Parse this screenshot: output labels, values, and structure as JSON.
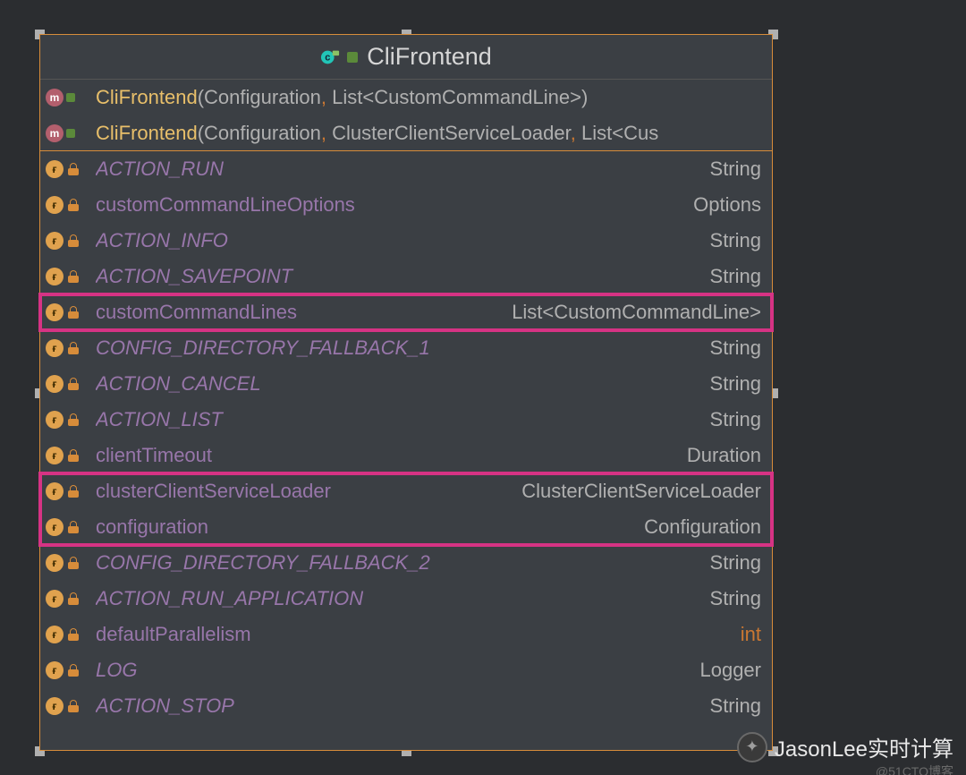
{
  "title": "CliFrontend",
  "constructors": [
    {
      "name": "CliFrontend",
      "sig_html": "(Configuration, List<CustomCommandLine>)"
    },
    {
      "name": "CliFrontend",
      "sig_html": "(Configuration, ClusterClientServiceLoader, List<Cus"
    }
  ],
  "fields": [
    {
      "name": "ACTION_RUN",
      "type": "String",
      "static": true
    },
    {
      "name": "customCommandLineOptions",
      "type": "Options",
      "static": false
    },
    {
      "name": "ACTION_INFO",
      "type": "String",
      "static": true
    },
    {
      "name": "ACTION_SAVEPOINT",
      "type": "String",
      "static": true
    },
    {
      "name": "customCommandLines",
      "type": "List<CustomCommandLine>",
      "static": false,
      "hl": 1
    },
    {
      "name": "CONFIG_DIRECTORY_FALLBACK_1",
      "type": "String",
      "static": true
    },
    {
      "name": "ACTION_CANCEL",
      "type": "String",
      "static": true
    },
    {
      "name": "ACTION_LIST",
      "type": "String",
      "static": true
    },
    {
      "name": "clientTimeout",
      "type": "Duration",
      "static": false
    },
    {
      "name": "clusterClientServiceLoader",
      "type": "ClusterClientServiceLoader",
      "static": false,
      "hl": 2
    },
    {
      "name": "configuration",
      "type": "Configuration",
      "static": false,
      "hl": 2
    },
    {
      "name": "CONFIG_DIRECTORY_FALLBACK_2",
      "type": "String",
      "static": true
    },
    {
      "name": "ACTION_RUN_APPLICATION",
      "type": "String",
      "static": true
    },
    {
      "name": "defaultParallelism",
      "type": "int",
      "static": false,
      "int": true
    },
    {
      "name": "LOG",
      "type": "Logger",
      "static": true
    },
    {
      "name": "ACTION_STOP",
      "type": "String",
      "static": true
    }
  ],
  "watermark": {
    "text": "JasonLee实时计算",
    "sub": "@51CTO博客"
  }
}
